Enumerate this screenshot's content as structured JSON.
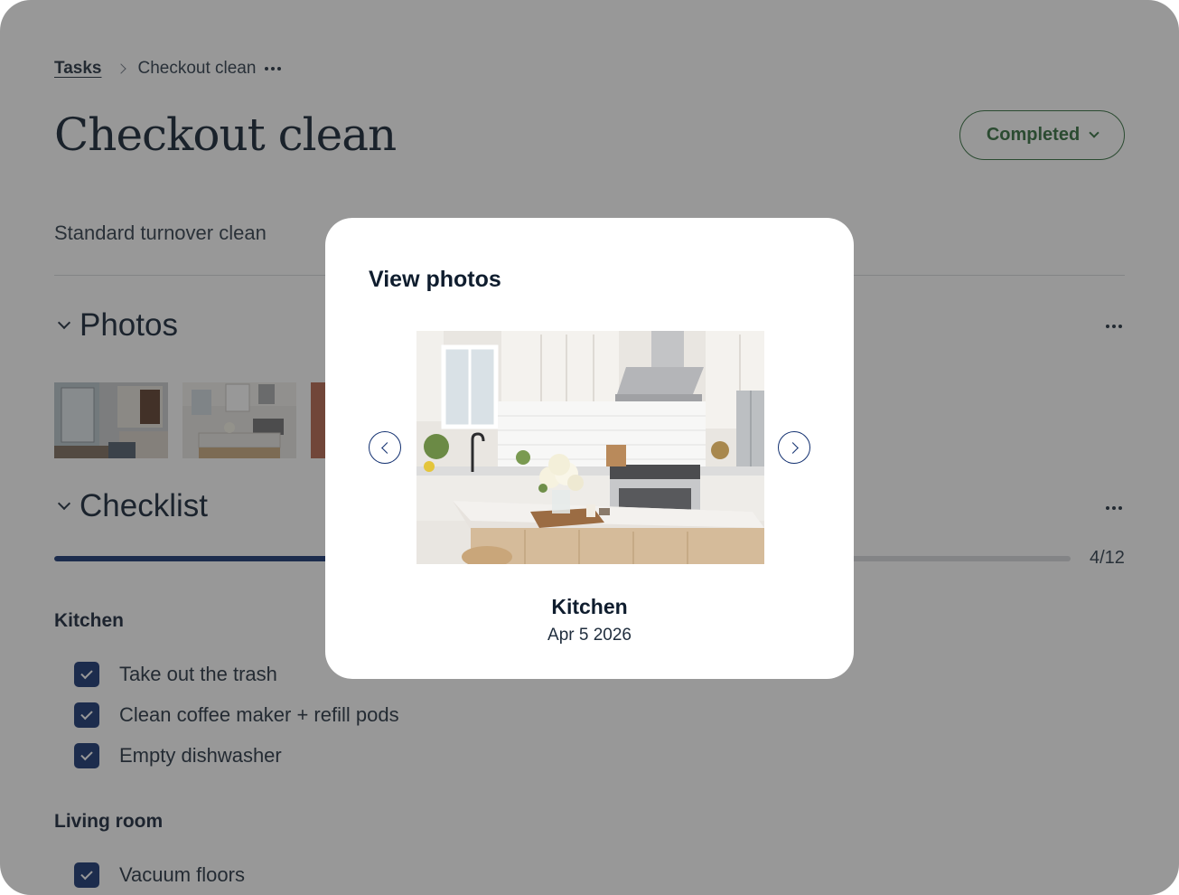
{
  "breadcrumb": {
    "root": "Tasks",
    "current": "Checkout clean"
  },
  "page": {
    "title": "Checkout clean",
    "status": "Completed",
    "description": "Standard turnover clean"
  },
  "sections": {
    "photos": "Photos",
    "checklist": "Checklist"
  },
  "checklist": {
    "progress": {
      "done": 4,
      "total": 12,
      "label": "4/12"
    },
    "groups": [
      {
        "title": "Kitchen",
        "items": [
          {
            "label": "Take out the trash",
            "checked": true
          },
          {
            "label": "Clean coffee maker + refill pods",
            "checked": true
          },
          {
            "label": "Empty dishwasher",
            "checked": true
          }
        ]
      },
      {
        "title": "Living room",
        "items": [
          {
            "label": "Vacuum floors",
            "checked": true
          }
        ]
      }
    ]
  },
  "modal": {
    "title": "View photos",
    "caption": "Kitchen",
    "date": "Apr 5 2026"
  },
  "colors": {
    "accent": "#123070",
    "status_green": "#2e6b3a",
    "overlay": "rgba(40,40,40,0.48)"
  },
  "icons": {
    "breadcrumb_separator": "chevron-right-icon",
    "more": "more-horizontal-icon",
    "section_toggle": "chevron-down-icon",
    "checkbox": "checkmark-icon",
    "prev": "chevron-left-icon",
    "next": "chevron-right-icon"
  }
}
